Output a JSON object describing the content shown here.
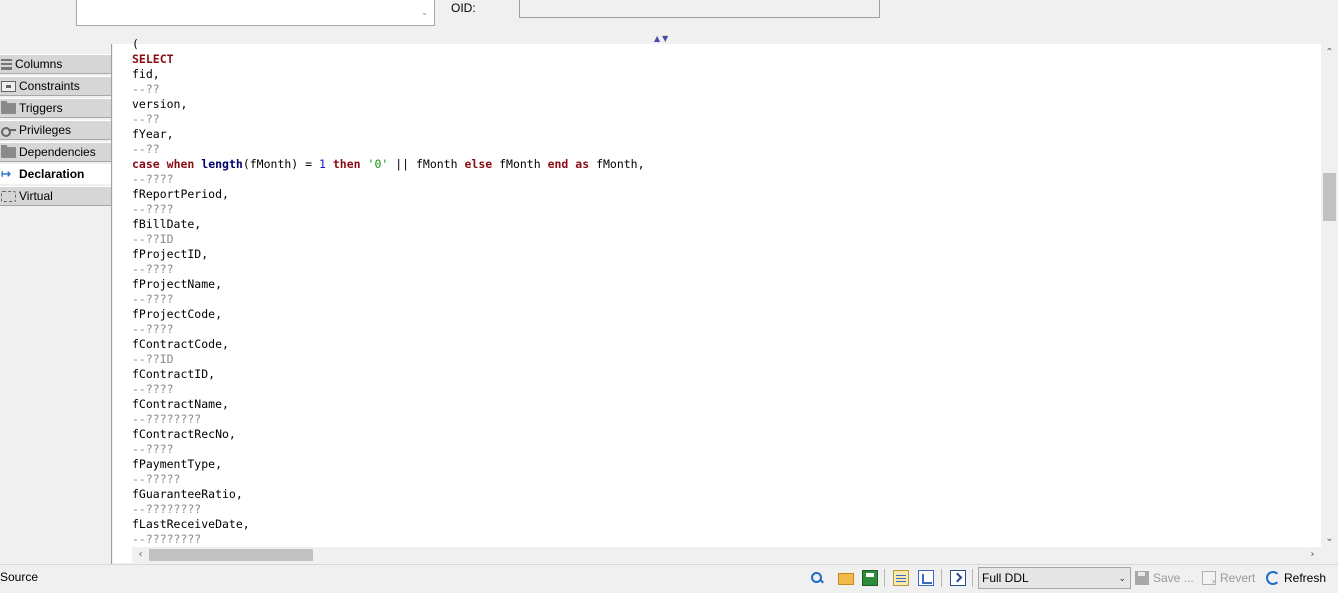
{
  "top": {
    "oid_label": "OID:",
    "oid_value": "",
    "description_value": ""
  },
  "tabs": [
    {
      "label": "Columns",
      "icon": "columns-icon",
      "active": false
    },
    {
      "label": "Constraints",
      "icon": "constraints-icon",
      "active": false
    },
    {
      "label": "Triggers",
      "icon": "folder-icon",
      "active": false
    },
    {
      "label": "Privileges",
      "icon": "key-icon",
      "active": false
    },
    {
      "label": "Dependencies",
      "icon": "folder-icon",
      "active": false
    },
    {
      "label": "Declaration",
      "icon": "declaration-icon",
      "active": true
    },
    {
      "label": "Virtual",
      "icon": "virtual-icon",
      "active": false
    }
  ],
  "code_lines": [
    [
      [
        "plain",
        "("
      ]
    ],
    [
      [
        "kw",
        "SELECT"
      ]
    ],
    [
      [
        "plain",
        "fid,"
      ]
    ],
    [
      [
        "cmt",
        "--??"
      ]
    ],
    [
      [
        "plain",
        "version,"
      ]
    ],
    [
      [
        "cmt",
        "--??"
      ]
    ],
    [
      [
        "plain",
        "fYear,"
      ]
    ],
    [
      [
        "cmt",
        "--??"
      ]
    ],
    [
      [
        "kw",
        "case"
      ],
      [
        "plain",
        " "
      ],
      [
        "kw",
        "when"
      ],
      [
        "plain",
        " "
      ],
      [
        "fn",
        "length"
      ],
      [
        "plain",
        "(fMonth) = "
      ],
      [
        "num",
        "1"
      ],
      [
        "plain",
        " "
      ],
      [
        "kw",
        "then"
      ],
      [
        "plain",
        " "
      ],
      [
        "str",
        "'0'"
      ],
      [
        "plain",
        " || fMonth "
      ],
      [
        "kw",
        "else"
      ],
      [
        "plain",
        " fMonth "
      ],
      [
        "kw",
        "end"
      ],
      [
        "plain",
        " "
      ],
      [
        "kw",
        "as"
      ],
      [
        "plain",
        " fMonth,"
      ]
    ],
    [
      [
        "cmt",
        "--????"
      ]
    ],
    [
      [
        "plain",
        "fReportPeriod,"
      ]
    ],
    [
      [
        "cmt",
        "--????"
      ]
    ],
    [
      [
        "plain",
        "fBillDate,"
      ]
    ],
    [
      [
        "cmt",
        "--??ID"
      ]
    ],
    [
      [
        "plain",
        "fProjectID,"
      ]
    ],
    [
      [
        "cmt",
        "--????"
      ]
    ],
    [
      [
        "plain",
        "fProjectName,"
      ]
    ],
    [
      [
        "cmt",
        "--????"
      ]
    ],
    [
      [
        "plain",
        "fProjectCode,"
      ]
    ],
    [
      [
        "cmt",
        "--????"
      ]
    ],
    [
      [
        "plain",
        "fContractCode,"
      ]
    ],
    [
      [
        "cmt",
        "--??ID"
      ]
    ],
    [
      [
        "plain",
        "fContractID,"
      ]
    ],
    [
      [
        "cmt",
        "--????"
      ]
    ],
    [
      [
        "plain",
        "fContractName,"
      ]
    ],
    [
      [
        "cmt",
        "--????????"
      ]
    ],
    [
      [
        "plain",
        "fContractRecNo,"
      ]
    ],
    [
      [
        "cmt",
        "--????"
      ]
    ],
    [
      [
        "plain",
        "fPaymentType,"
      ]
    ],
    [
      [
        "cmt",
        "--?????"
      ]
    ],
    [
      [
        "plain",
        "fGuaranteeRatio,"
      ]
    ],
    [
      [
        "cmt",
        "--????????"
      ]
    ],
    [
      [
        "plain",
        "fLastReceiveDate,"
      ]
    ],
    [
      [
        "cmt",
        "--????????"
      ]
    ]
  ],
  "bottom": {
    "source_label": "Source",
    "ddl_mode": "Full DDL",
    "save_label": "Save ...",
    "revert_label": "Revert",
    "refresh_label": "Refresh"
  },
  "colors": {
    "keyword": "#8b0b14",
    "function": "#00006b",
    "string": "#148a14",
    "number": "#1414c8",
    "comment": "#8a8a8a"
  }
}
